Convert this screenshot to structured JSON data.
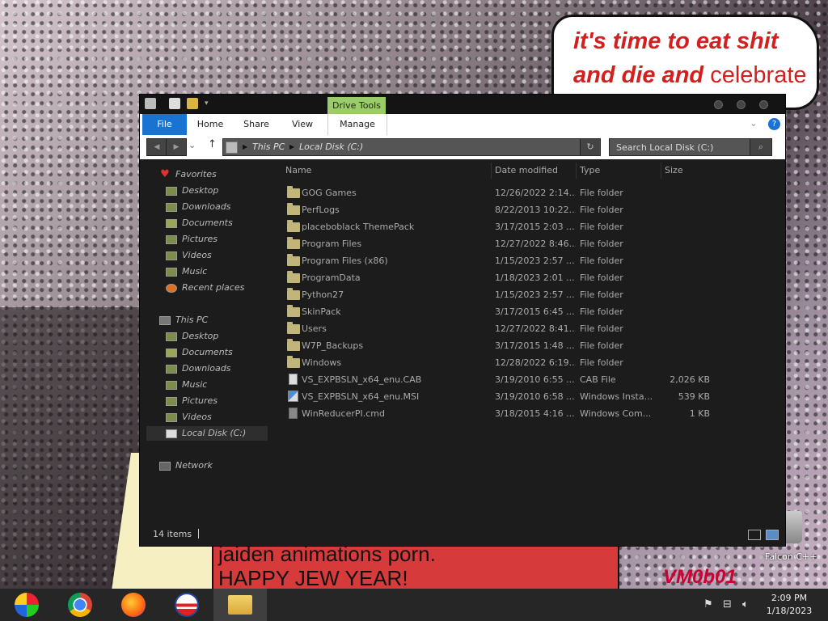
{
  "wallpaper": {
    "bubble_line1": "it's time to eat shit",
    "bubble_line2_bold": "and die and",
    "bubble_line2_normal": "celebrate",
    "banner_line1": "jaiden animations porn.",
    "banner_line2": "HAPPY JEW YEAR!",
    "logo": "VM0b01"
  },
  "desktop": {
    "recycle_bin_label": "Falcon C++"
  },
  "window": {
    "context_tab": "Drive Tools",
    "ribbon_tabs": [
      "File",
      "Home",
      "Share",
      "View",
      "Manage"
    ],
    "address": {
      "crumbs": [
        "This PC",
        "Local Disk (C:)"
      ]
    },
    "search_placeholder": "Search Local Disk (C:)",
    "sidebar": {
      "favorites_header": "Favorites",
      "favorites": [
        "Desktop",
        "Downloads",
        "Documents",
        "Pictures",
        "Videos",
        "Music",
        "Recent places"
      ],
      "thispc_header": "This PC",
      "thispc": [
        "Desktop",
        "Documents",
        "Downloads",
        "Music",
        "Pictures",
        "Videos",
        "Local Disk (C:)"
      ],
      "network": "Network"
    },
    "columns": [
      "Name",
      "Date modified",
      "Type",
      "Size"
    ],
    "files": [
      {
        "name": "GOG Games",
        "date": "12/26/2022 2:14...",
        "type": "File folder",
        "size": "",
        "icon": "folder"
      },
      {
        "name": "PerfLogs",
        "date": "8/22/2013 10:22...",
        "type": "File folder",
        "size": "",
        "icon": "folder"
      },
      {
        "name": "placeboblack ThemePack",
        "date": "3/17/2015 2:03 ...",
        "type": "File folder",
        "size": "",
        "icon": "folder"
      },
      {
        "name": "Program Files",
        "date": "12/27/2022 8:46...",
        "type": "File folder",
        "size": "",
        "icon": "folder"
      },
      {
        "name": "Program Files (x86)",
        "date": "1/15/2023 2:57 ...",
        "type": "File folder",
        "size": "",
        "icon": "folder"
      },
      {
        "name": "ProgramData",
        "date": "1/18/2023 2:01 ...",
        "type": "File folder",
        "size": "",
        "icon": "folder"
      },
      {
        "name": "Python27",
        "date": "1/15/2023 2:57 ...",
        "type": "File folder",
        "size": "",
        "icon": "folder"
      },
      {
        "name": "SkinPack",
        "date": "3/17/2015 6:45 ...",
        "type": "File folder",
        "size": "",
        "icon": "folder"
      },
      {
        "name": "Users",
        "date": "12/27/2022 8:41...",
        "type": "File folder",
        "size": "",
        "icon": "folder"
      },
      {
        "name": "W7P_Backups",
        "date": "3/17/2015 1:48 ...",
        "type": "File folder",
        "size": "",
        "icon": "folder"
      },
      {
        "name": "Windows",
        "date": "12/28/2022 6:19...",
        "type": "File folder",
        "size": "",
        "icon": "folder"
      },
      {
        "name": "VS_EXPBSLN_x64_enu.CAB",
        "date": "3/19/2010 6:55 ...",
        "type": "CAB File",
        "size": "2,026 KB",
        "icon": "file"
      },
      {
        "name": "VS_EXPBSLN_x64_enu.MSI",
        "date": "3/19/2010 6:58 ...",
        "type": "Windows Insta...",
        "size": "539 KB",
        "icon": "msi"
      },
      {
        "name": "WinReducerPI.cmd",
        "date": "3/18/2015 4:16 ...",
        "type": "Windows Com...",
        "size": "1 KB",
        "icon": "cmd"
      }
    ],
    "status": "14 items"
  },
  "taskbar": {
    "apps": [
      "start-orb",
      "chrome",
      "firefox",
      "obama",
      "file-explorer"
    ],
    "time": "2:09 PM",
    "date": "1/18/2023"
  },
  "colors": {
    "accent": "#1873d3",
    "drive_tools": "#9ccb6a",
    "window_bg": "#1c1c1c",
    "text": "#aaaaaa"
  }
}
